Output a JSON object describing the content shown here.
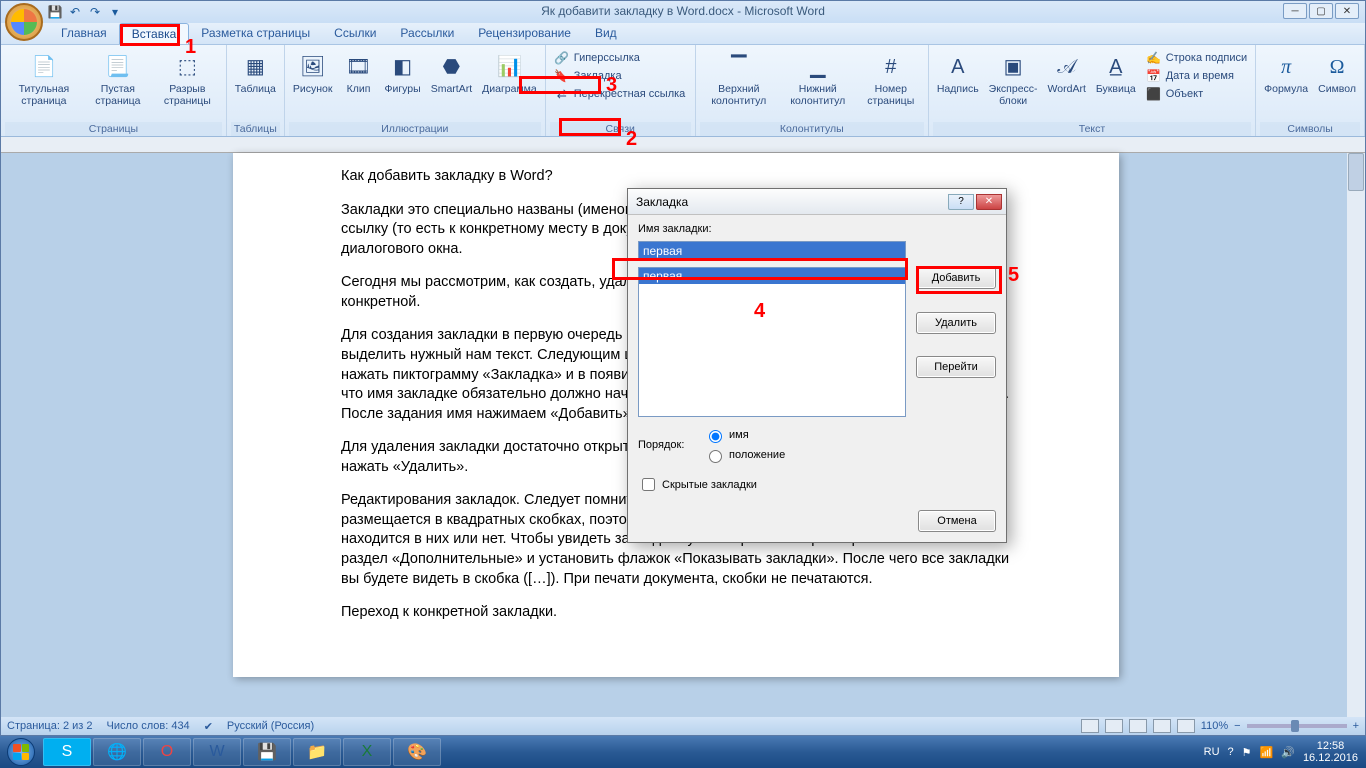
{
  "app": {
    "title": "Як добавити закладку в Word.docx - Microsoft Word"
  },
  "tabs": {
    "items": [
      "Главная",
      "Вставка",
      "Разметка страницы",
      "Ссылки",
      "Рассылки",
      "Рецензирование",
      "Вид"
    ],
    "active_index": 1
  },
  "ribbon": {
    "pages": {
      "cover": "Титульная страница",
      "blank": "Пустая страница",
      "break": "Разрыв страницы",
      "label": "Страницы"
    },
    "tables": {
      "table": "Таблица",
      "label": "Таблицы"
    },
    "illus": {
      "pic": "Рисунок",
      "clip": "Клип",
      "shapes": "Фигуры",
      "smartart": "SmartArt",
      "chart": "Диаграмма",
      "label": "Иллюстрации"
    },
    "links": {
      "hyper": "Гиперссылка",
      "bookmark": "Закладка",
      "cross": "Перекрестная ссылка",
      "label": "Связи"
    },
    "headfoot": {
      "header": "Верхний колонтитул",
      "footer": "Нижний колонтитул",
      "pagenum": "Номер страницы",
      "label": "Колонтитулы"
    },
    "text": {
      "textbox": "Надпись",
      "quick": "Экспресс-блоки",
      "wordart": "WordArt",
      "dropcap": "Буквица",
      "sig": "Строка подписи",
      "date": "Дата и время",
      "object": "Объект",
      "label": "Текст"
    },
    "symbols": {
      "equation": "Формула",
      "symbol": "Символ",
      "label": "Символы"
    }
  },
  "document": {
    "p1": "Как добавить закладку в Word?",
    "p2": "Закладки это специально названы (именованы) места в документе на которые можно сделать ссылку (то есть к конкретному месту в документе привязывается ссылка), или перейти с помощью диалогового окна.",
    "p3": "Сегодня мы рассмотрим, как создать, удалить и отредактировать закладки и перейти к конкретной.",
    "p4": "Для создания закладки в первую очередь нам нужно названия места с помощью нашей закладки выделить нужный нам текст. Следующим шагом на вкладке «Вставка» в разделе «Связи» нужно нажать пиктограмму «Закладка» и в появившемся окружении задать ей имя. Следует помнить, что имя закладке обязательно должно начинаться с буквы и не может содержать в себе пробелов. После задания имя нажимаем «Добавить».",
    "p5": "Для удаления закладки достаточно открыть то же окно, в списке закладок выбрать нужную и нажать «Удалить».",
    "p6": "Редактирования закладок. Следует помнить, что когда Вы добавляете текст в закладки, он размещается в квадратных скобках, поэтому, следует проверять текст после редактирования,  находится в них или нет. Чтобы увидеть закладки нужно перейти в параметры Microsoft Word в раздел «Дополнительные» и установить флажок «Показывать закладки». После чего все закладки вы будете видеть в скобка ([…]). При печати документа, скобки не печатаются.",
    "p7": "Переход к конкретной закладки."
  },
  "dialog": {
    "title": "Закладка",
    "name_label": "Имя закладки:",
    "name_value": "первая",
    "list_item": "первая",
    "btn_add": "Добавить",
    "btn_del": "Удалить",
    "btn_goto": "Перейти",
    "sort_label": "Порядок:",
    "sort_name": "имя",
    "sort_pos": "положение",
    "hidden": "Скрытые закладки",
    "btn_cancel": "Отмена"
  },
  "status": {
    "page": "Страница: 2 из 2",
    "words": "Число слов: 434",
    "lang": "Русский (Россия)",
    "zoom": "110%"
  },
  "annotations": {
    "l1": "1",
    "l2": "2",
    "l3": "3",
    "l4": "4",
    "l5": "5"
  },
  "tray": {
    "lang": "RU",
    "time": "12:58",
    "date": "16.12.2016"
  }
}
